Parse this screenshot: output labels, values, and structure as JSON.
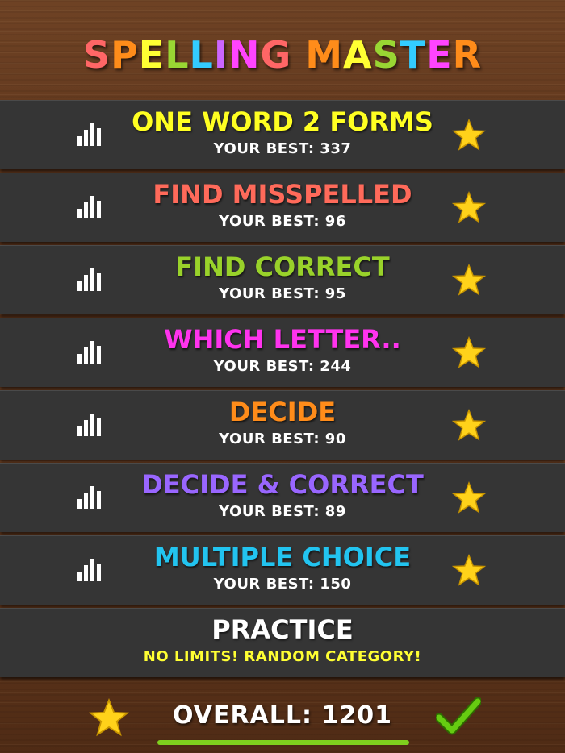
{
  "title": {
    "letters": [
      {
        "ch": "S",
        "color": "#ff6666"
      },
      {
        "ch": "P",
        "color": "#ff8c1a"
      },
      {
        "ch": "E",
        "color": "#ffff33"
      },
      {
        "ch": "L",
        "color": "#99d633"
      },
      {
        "ch": "L",
        "color": "#33ccff"
      },
      {
        "ch": "I",
        "color": "#cc66ff"
      },
      {
        "ch": "N",
        "color": "#ff44ff"
      },
      {
        "ch": "G",
        "color": "#ff6666"
      },
      {
        "ch": " ",
        "color": "#ffffff"
      },
      {
        "ch": "M",
        "color": "#ff8c1a"
      },
      {
        "ch": "A",
        "color": "#ffff33"
      },
      {
        "ch": "S",
        "color": "#99d633"
      },
      {
        "ch": "T",
        "color": "#33ccff"
      },
      {
        "ch": "E",
        "color": "#ff44ff"
      },
      {
        "ch": "R",
        "color": "#ff8c1a"
      }
    ]
  },
  "modes": [
    {
      "label": "ONE WORD 2 FORMS",
      "best": "YOUR BEST: 337",
      "color": "#ffff22"
    },
    {
      "label": "FIND MISSPELLED",
      "best": "YOUR BEST: 96",
      "color": "#ff6a5a"
    },
    {
      "label": "FIND CORRECT",
      "best": "YOUR BEST: 95",
      "color": "#99d22a"
    },
    {
      "label": "WHICH LETTER..",
      "best": "YOUR BEST: 244",
      "color": "#ff33ee"
    },
    {
      "label": "DECIDE",
      "best": "YOUR BEST: 90",
      "color": "#ff8c1a"
    },
    {
      "label": "DECIDE & CORRECT",
      "best": "YOUR BEST: 89",
      "color": "#9966ff"
    },
    {
      "label": "MULTIPLE CHOICE",
      "best": "YOUR BEST: 150",
      "color": "#22c4f0"
    }
  ],
  "practice": {
    "label": "PRACTICE",
    "subtitle": "NO LIMITS! RANDOM CATEGORY!"
  },
  "footer": {
    "overall": "OVERALL: 1201",
    "bar_color": "#7fcf1e",
    "check_color": "#66cc11"
  },
  "icons": {
    "stats": "bar-chart-icon",
    "star": "star-icon",
    "check": "checkmark-icon"
  }
}
